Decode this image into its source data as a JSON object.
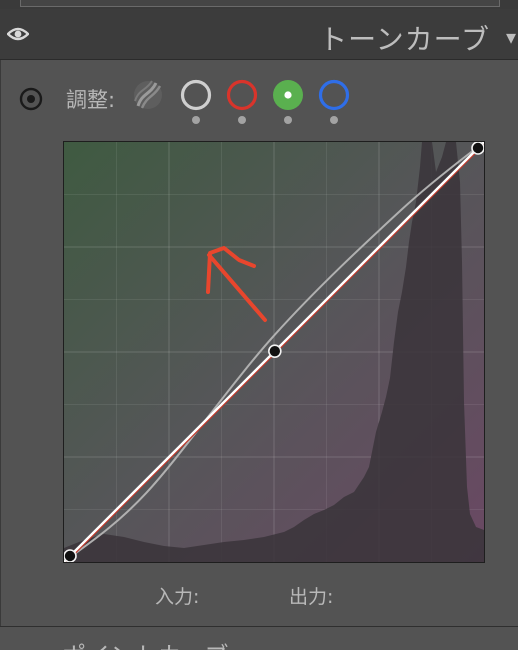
{
  "header": {
    "title": "トーンカーブ",
    "visibility_icon": "eye-icon",
    "collapse_icon": "chevron-down-icon"
  },
  "toolbar": {
    "target_icon": "target-adjust-icon",
    "adjust_label": "調整:",
    "channels": [
      {
        "name": "parametric",
        "icon": "parametric-curve-icon",
        "color": "#8a8a8a",
        "selected": false
      },
      {
        "name": "point-rgb",
        "icon": "circle-outline-icon",
        "color": "#cfcfcf",
        "selected": false
      },
      {
        "name": "red",
        "icon": "circle-outline-icon",
        "color": "#d9342b",
        "selected": false
      },
      {
        "name": "green",
        "icon": "circle-filled-icon",
        "color": "#5ab04f",
        "selected": true
      },
      {
        "name": "blue",
        "icon": "circle-outline-icon",
        "color": "#2f6ee8",
        "selected": false
      }
    ]
  },
  "curve": {
    "input_range": [
      0,
      255
    ],
    "output_range": [
      0,
      255
    ],
    "active_points": [
      [
        0,
        0
      ],
      [
        128,
        128
      ],
      [
        255,
        255
      ]
    ],
    "rgb_composite_points": [
      [
        0,
        0
      ],
      [
        50,
        42
      ],
      [
        128,
        138
      ],
      [
        205,
        214
      ],
      [
        255,
        255
      ]
    ],
    "active_color": "#ffffff",
    "composite_color": "#b0b0b0",
    "red_channel_color": "#c0392b",
    "annotation_color": "#e8462d"
  },
  "readout": {
    "input_label": "入力:",
    "output_label": "出力:"
  },
  "next_section": {
    "title_peek": "ポイントカーブ"
  }
}
